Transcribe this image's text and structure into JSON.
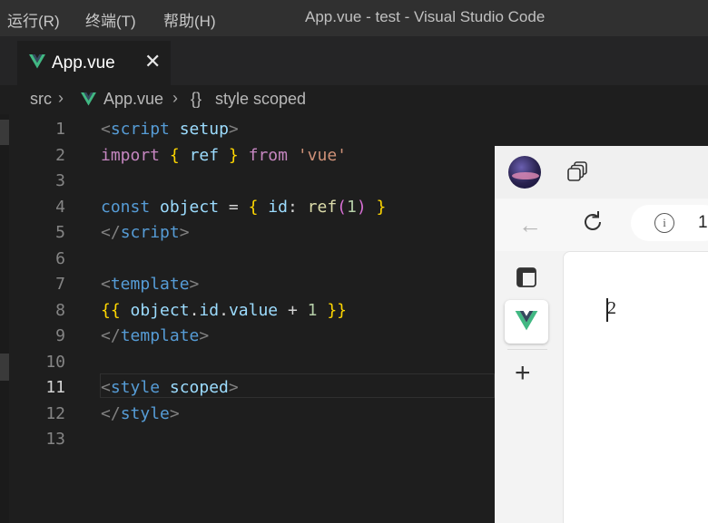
{
  "menubar": {
    "items": [
      "运行(R)",
      "终端(T)",
      "帮助(H)"
    ]
  },
  "window": {
    "title": "App.vue - test - Visual Studio Code"
  },
  "editor_tab": {
    "label": "App.vue",
    "close_glyph": "✕"
  },
  "breadcrumb": {
    "folder": "src",
    "file": "App.vue",
    "symbol_icon": "{}",
    "symbol": "style scoped"
  },
  "code": {
    "line_numbers": [
      "1",
      "2",
      "3",
      "4",
      "5",
      "6",
      "7",
      "8",
      "9",
      "10",
      "11",
      "12",
      "13"
    ],
    "active_line": "11"
  },
  "browser": {
    "back_glyph": "←",
    "url_partial": "1",
    "info_glyph": "i",
    "page_content": "2",
    "plus_glyph": "+"
  },
  "colors": {
    "editor_bg": "#1e1e1e",
    "titlebar_bg": "#303030",
    "vue_green": "#41b883",
    "vue_dark": "#35495e"
  }
}
